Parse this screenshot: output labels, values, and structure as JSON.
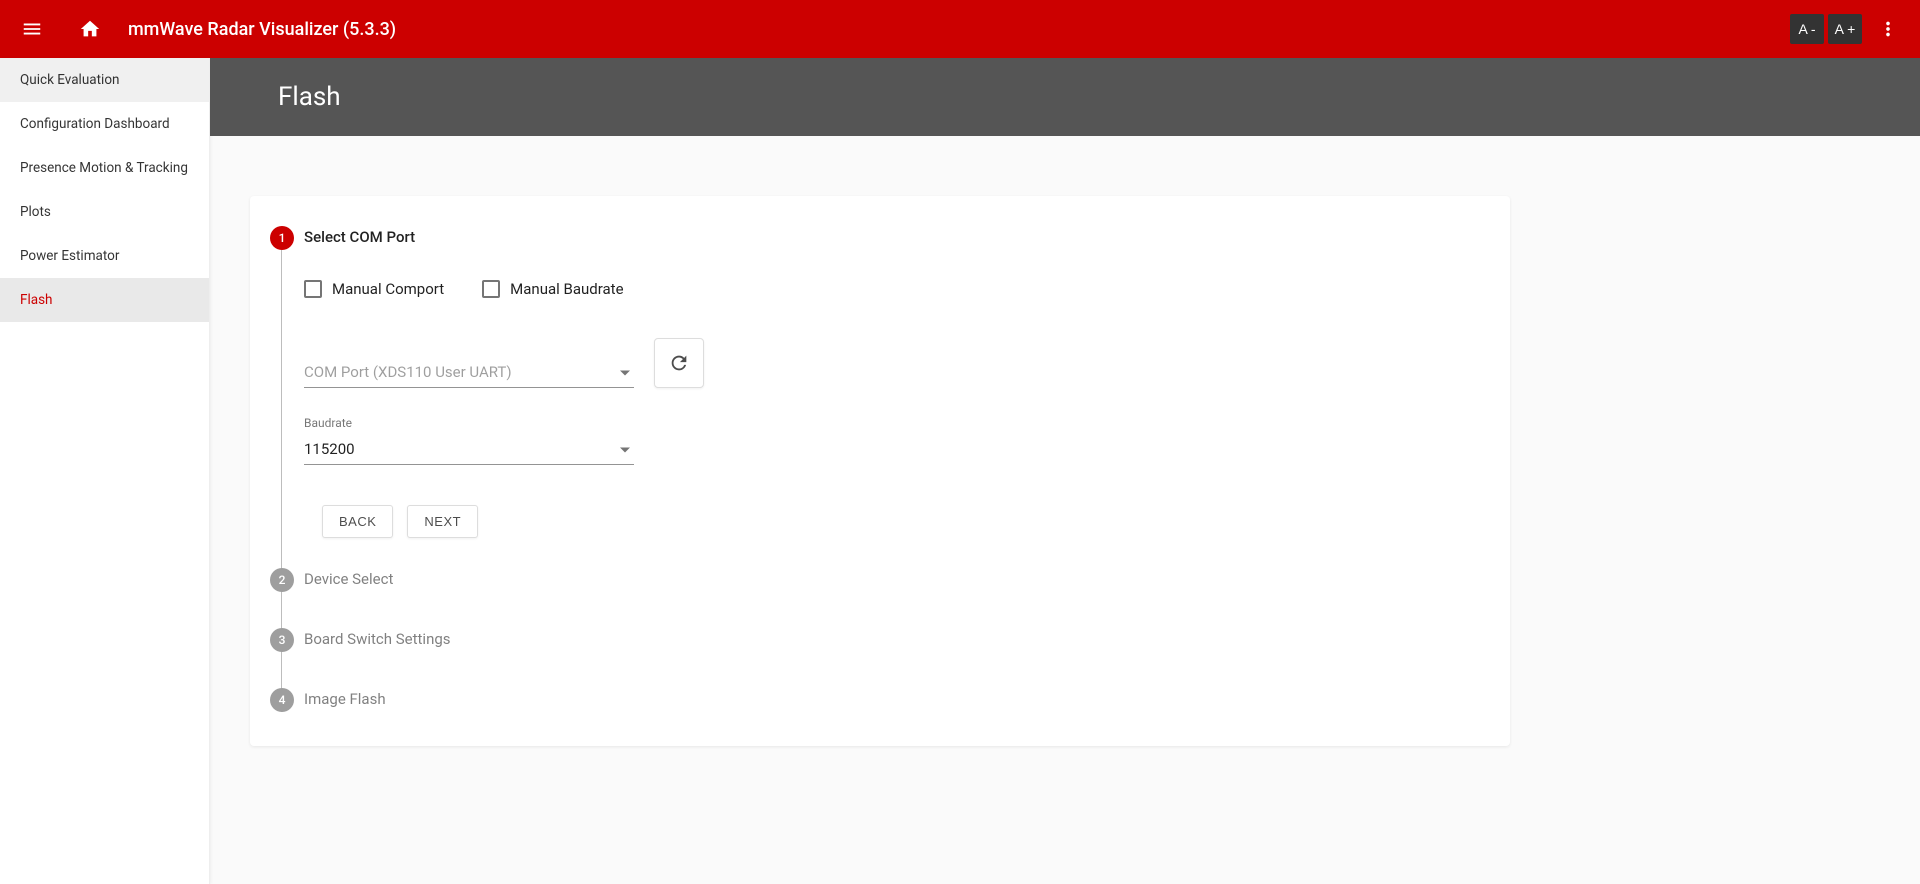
{
  "header": {
    "title": "mmWave Radar Visualizer (5.3.3)",
    "font_decrease": "A -",
    "font_increase": "A +"
  },
  "sidebar": {
    "items": [
      {
        "label": "Quick Evaluation"
      },
      {
        "label": "Configuration Dashboard"
      },
      {
        "label": "Presence Motion & Tracking"
      },
      {
        "label": "Plots"
      },
      {
        "label": "Power Estimator"
      },
      {
        "label": "Flash"
      }
    ]
  },
  "page": {
    "title": "Flash"
  },
  "stepper": {
    "steps": [
      {
        "num": "1",
        "label": "Select COM Port"
      },
      {
        "num": "2",
        "label": "Device Select"
      },
      {
        "num": "3",
        "label": "Board Switch Settings"
      },
      {
        "num": "4",
        "label": "Image Flash"
      }
    ]
  },
  "step1": {
    "checkbox_manual_comport": "Manual Comport",
    "checkbox_manual_baudrate": "Manual Baudrate",
    "comport_placeholder": "COM Port (XDS110 User UART)",
    "baudrate_label": "Baudrate",
    "baudrate_value": "115200",
    "back_label": "BACK",
    "next_label": "NEXT"
  }
}
